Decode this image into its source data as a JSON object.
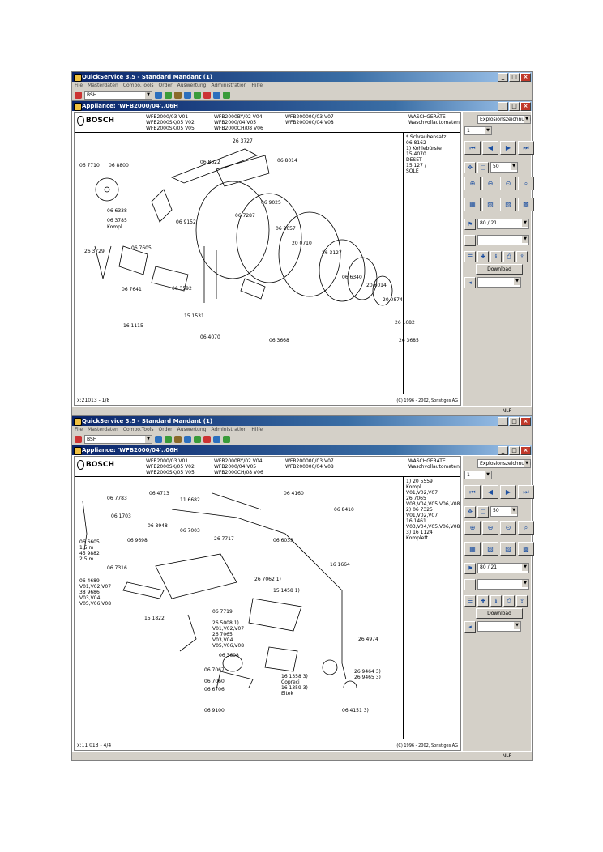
{
  "app": {
    "title": "QuickService 3.5 - Standard Mandant (1)",
    "menu": [
      "File",
      "Masterdaten",
      "Combo.Tools",
      "Order",
      "Auswertung",
      "Administration",
      "Hilfe"
    ],
    "toolbar_select": "BSH",
    "status": "NLF"
  },
  "panel": {
    "select_top": "Explosionszeichnung",
    "page_num": "1",
    "zoom_value": "50",
    "select_mid": "80 / 21",
    "download_label": "Download"
  },
  "screens": [
    {
      "window_title": "Appliance: 'WFB2000/04'..06H",
      "brand": "BOSCH",
      "models_col1": [
        "WFB2000/03 V01",
        "WFB2000SK/05 V02",
        "WFB2000SK/05 V05"
      ],
      "models_col2": [
        "WFB2000BY/02 V04",
        "WFB2000/04 V05",
        "WFB2000CH/08 V06"
      ],
      "models_col3": [
        "WFB200000/03 V07",
        "WFB200000/04 V08"
      ],
      "category": [
        "WASCHGERÄTE",
        "Waschvollautomaten"
      ],
      "notes": [
        "* Schraubensatz",
        "  06 8162",
        "1) Kohlebürste",
        "  15 4070",
        "  DESET",
        "  15 127 /",
        "  SOLE"
      ],
      "footer_left": "x:21013 - 1/8",
      "footer_right": "(C) 1996 - 2002, Sonstiges AG",
      "parts": [
        "06 8622",
        "26 3727",
        "06 7710",
        "06 8800",
        "06 8014",
        "06 9025",
        "06 6338",
        "06 3785",
        "Kompl.",
        "06 9152",
        "06 7287",
        "06 7605",
        "26 3729",
        "06 8657",
        "20 0710",
        "26 3127",
        "06 7641",
        "06 3592",
        "06 6340",
        "20 6014",
        "20 0874",
        "16 1115",
        "15 1531",
        "26 1682",
        "06 4070",
        "06 3668",
        "26 3685"
      ]
    },
    {
      "window_title": "Appliance: 'WFB2000/04'..06H",
      "brand": "BOSCH",
      "models_col1": [
        "WFB2000/03 V01",
        "WFB2000SK/05 V02",
        "WFB2000SK/05 V05"
      ],
      "models_col2": [
        "WFB2000BY/02 V04",
        "WFB2000/04 V05",
        "WFB2000CH/08 V06"
      ],
      "models_col3": [
        "WFB200000/03 V07",
        "WFB200000/04 V08"
      ],
      "category": [
        "WASCHGERÄTE",
        "Waschvollautomaten"
      ],
      "notes": [
        "1) 20 5559",
        "Kompl.",
        "V01,V02,V07",
        "26 7065",
        "V03,V04,V05,V06,V08",
        "2) 06 7325",
        "V01,V02,V07",
        "16 1461",
        "V03,V04,V05,V06,V08",
        "3) 16 1124",
        "Komplett"
      ],
      "footer_left": "x:11 013 - 4/4",
      "footer_right": "(C) 1996 - 2002, Sonstiges AG",
      "parts": [
        "06 7783",
        "06 4713",
        "11 6682",
        "06 4160",
        "06 1703",
        "06 8410",
        "06 8948",
        "06 7003",
        "06 6605",
        "1,5 m",
        "45 9882",
        "2,5 m",
        "26 7717",
        "06 6039",
        "06 9698",
        "06 7316",
        "16 1664",
        "06 4689",
        "V01,V02,V07",
        "38 9686",
        "V03,V04",
        "V05,V06,V08",
        "26 7062 1)",
        "15 1458 1)",
        "15 1822",
        "06 7719",
        "26 5008 1)",
        "V01,V02,V07",
        "26 7065",
        "V03,V04",
        "V05,V06,V08",
        "26 4974",
        "06 3608",
        "06 7067",
        "06 7060",
        "06 6706",
        "16 1358 3)",
        "Copreci",
        "16 1359 3)",
        "Eltek",
        "26 9464 3)",
        "26 9465 3)",
        "06 9100",
        "06 4151 3)"
      ]
    }
  ]
}
